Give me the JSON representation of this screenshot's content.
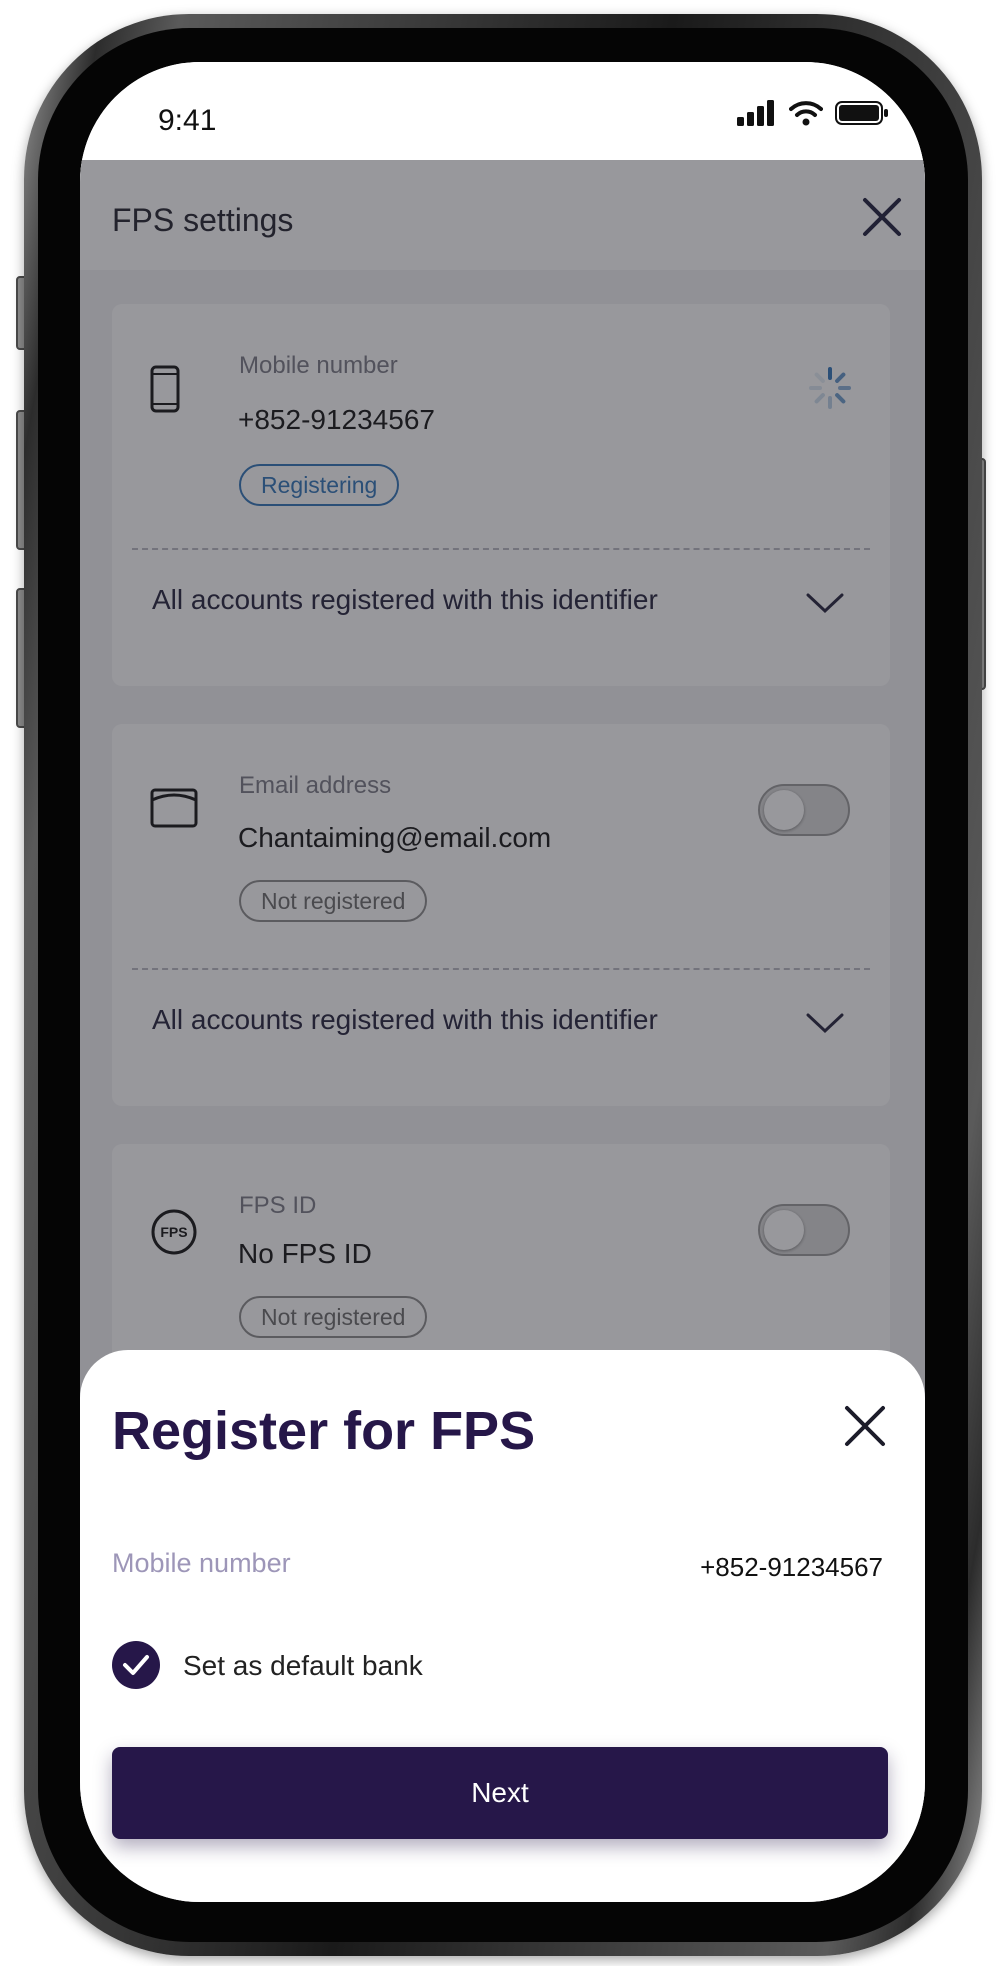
{
  "status_bar": {
    "time": "9:41",
    "icons": [
      "cellular-signal-icon",
      "wifi-icon",
      "battery-icon"
    ]
  },
  "page": {
    "title": "FPS settings",
    "close_icon": "close-icon",
    "cards": [
      {
        "icon": "mobile-phone-icon",
        "label": "Mobile number",
        "value": "+852-91234567",
        "status": "Registering",
        "status_color": "#2f74b8",
        "control": "loading-spinner-icon",
        "accordion_label": "All accounts registered with this identifier"
      },
      {
        "icon": "envelope-icon",
        "label": "Email address",
        "value": "Chantaiming@email.com",
        "status": "Not registered",
        "control": "toggle-off",
        "accordion_label": "All accounts registered with this identifier"
      },
      {
        "icon": "fps-logo-icon",
        "label": "FPS ID",
        "value": "No FPS ID",
        "status": "Not registered",
        "control": "toggle-off",
        "fps_logo_text": "FPS"
      }
    ]
  },
  "sheet": {
    "title": "Register for FPS",
    "close_icon": "close-icon",
    "field_label": "Mobile number",
    "field_value": "+852-91234567",
    "checkbox_label": "Set as default bank",
    "checkbox_checked": true,
    "next_label": "Next"
  },
  "colors": {
    "primary": "#261749",
    "registering": "#2f74b8",
    "muted_label": "#9d96b8"
  }
}
